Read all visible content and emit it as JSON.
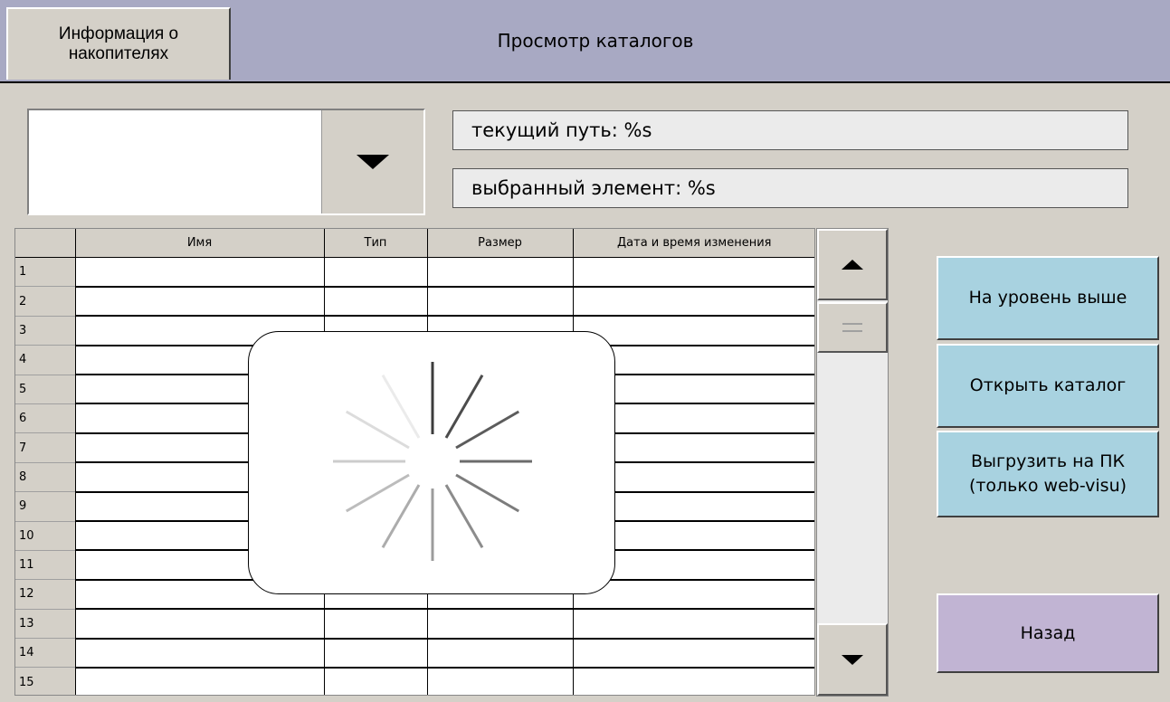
{
  "header": {
    "tab_info": "Информация о накопителях",
    "title": "Просмотр каталогов"
  },
  "combo": {
    "value": ""
  },
  "info": {
    "current_path": "текущий путь: %s",
    "selected_item": "выбранный элемент: %s"
  },
  "table": {
    "columns": [
      "Имя",
      "Тип",
      "Размер",
      "Дата и время изменения"
    ],
    "row_numbers": [
      "1",
      "2",
      "3",
      "4",
      "5",
      "6",
      "7",
      "8",
      "9",
      "10",
      "11",
      "12",
      "13",
      "14",
      "15"
    ]
  },
  "buttons": {
    "level_up": "На уровень выше",
    "open_dir": "Открыть каталог",
    "upload": "Выгрузить на ПК (только web-visu)",
    "back": "Назад"
  },
  "colors": {
    "header_bg": "#a8a9c3",
    "panel_bg": "#d4d0c8",
    "action_button": "#a8d2e0",
    "back_button": "#c1b4d3"
  },
  "icons": {
    "combo_toggle": "triangle-down-icon",
    "scroll_up": "triangle-up-icon",
    "scroll_down": "triangle-down-icon",
    "scroll_thumb": "grip-icon",
    "loading": "spinner-icon"
  }
}
